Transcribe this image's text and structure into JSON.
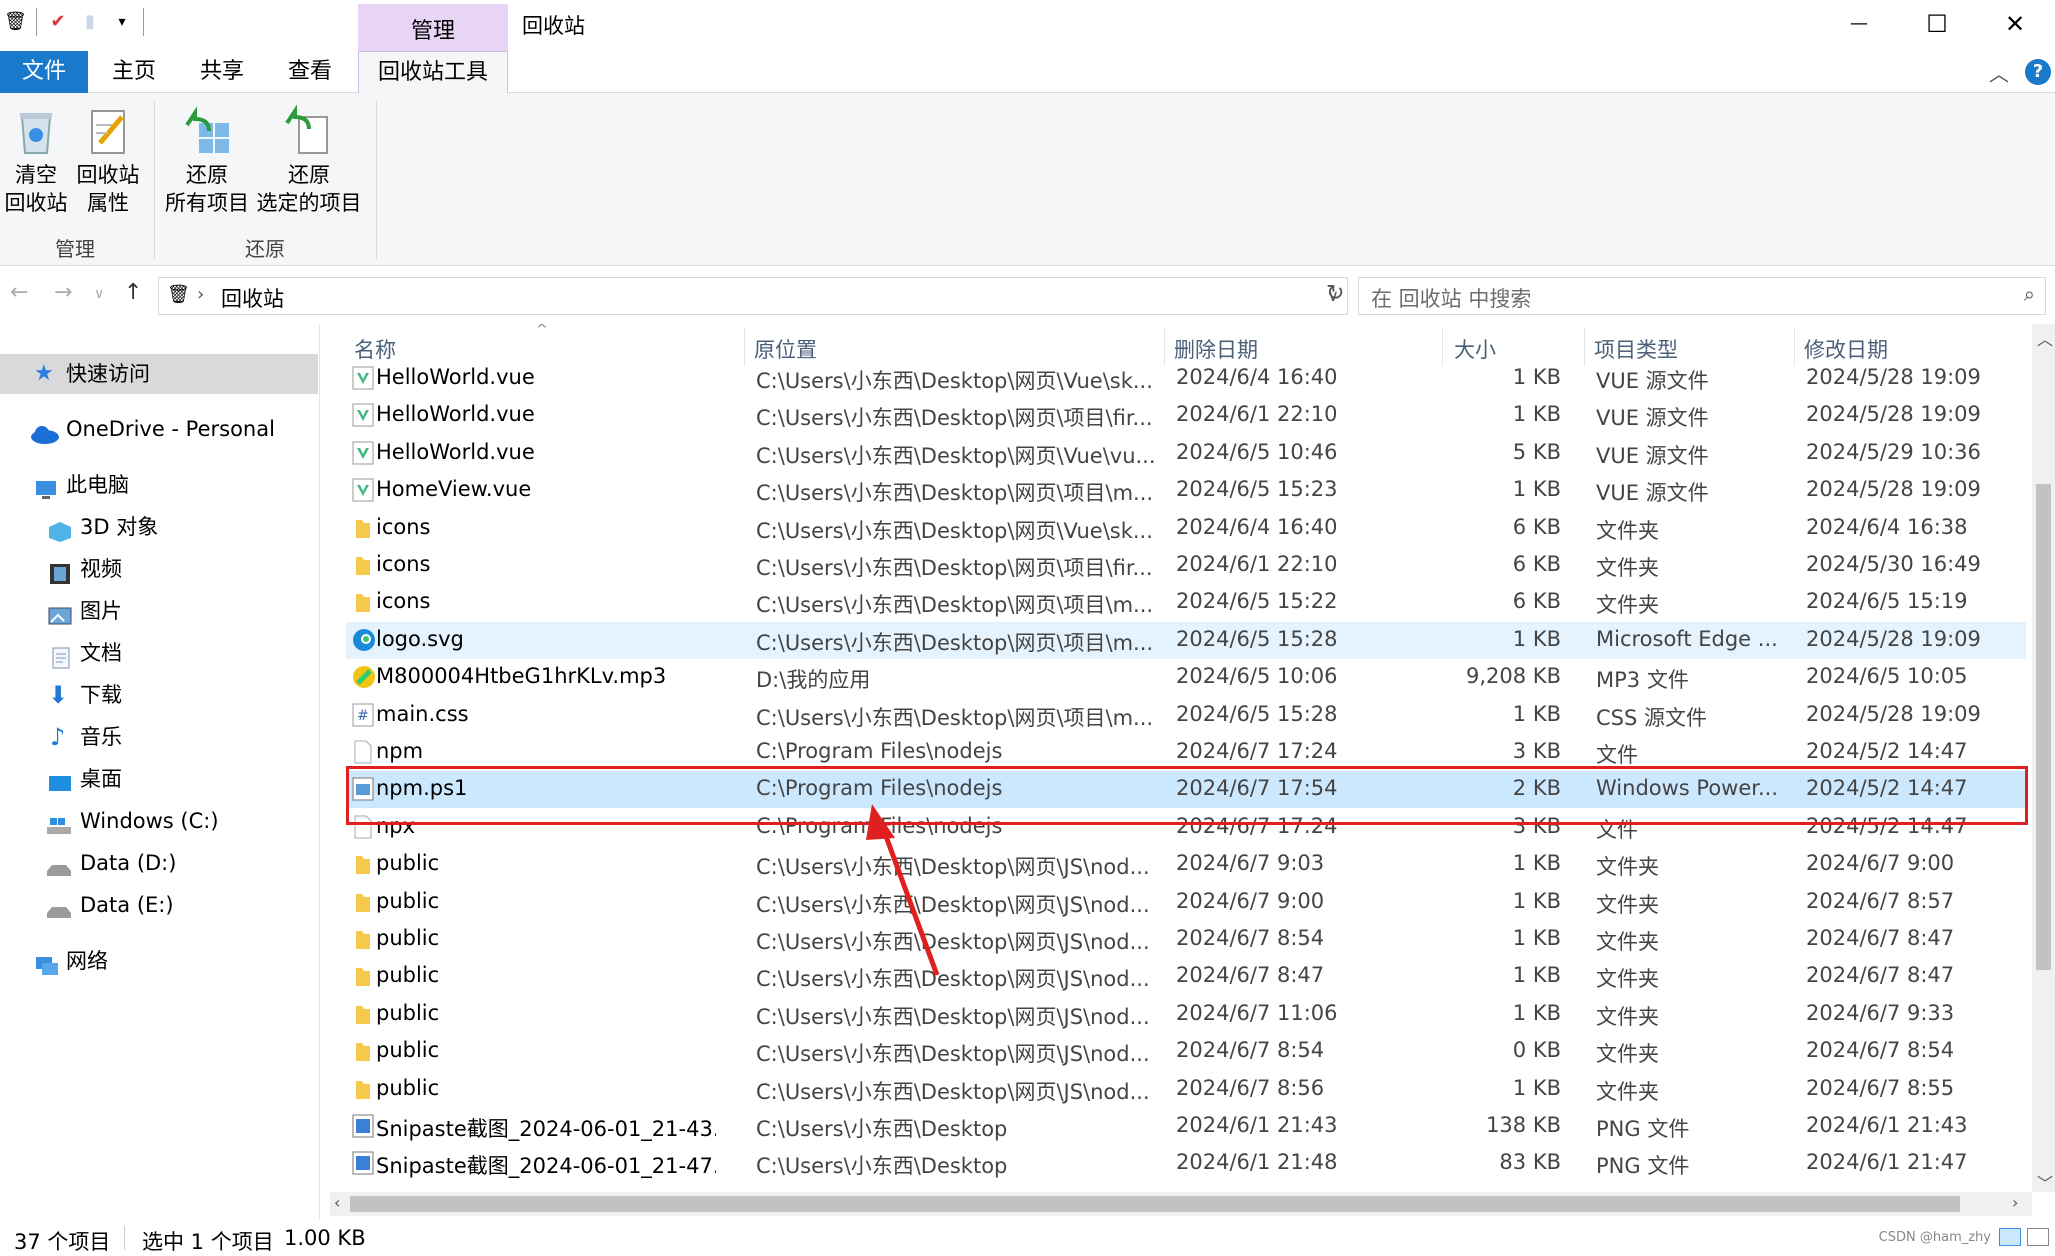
{
  "title_bar": {
    "context_tab": "管理",
    "window_title": "回收站",
    "minimize": "—",
    "maximize": "☐",
    "close": "✕"
  },
  "ribbon_tabs": {
    "file": "文件",
    "home": "主页",
    "share": "共享",
    "view": "查看",
    "recycle_tools": "回收站工具"
  },
  "ribbon": {
    "empty_bin": {
      "line1": "清空",
      "line2": "回收站"
    },
    "bin_props": {
      "line1": "回收站",
      "line2": "属性"
    },
    "restore_all": {
      "line1": "还原",
      "line2": "所有项目"
    },
    "restore_selected": {
      "line1": "还原",
      "line2": "选定的项目"
    },
    "group_manage": "管理",
    "group_restore": "还原"
  },
  "address": {
    "path": "回收站",
    "search_placeholder": "在 回收站 中搜索"
  },
  "nav": {
    "quick_access": "快速访问",
    "onedrive": "OneDrive - Personal",
    "this_pc": "此电脑",
    "objects_3d": "3D 对象",
    "videos": "视频",
    "pictures": "图片",
    "documents": "文档",
    "downloads": "下载",
    "music": "音乐",
    "desktop": "桌面",
    "drive_c": "Windows (C:)",
    "drive_d": "Data (D:)",
    "drive_e": "Data (E:)",
    "network": "网络"
  },
  "columns": {
    "name": "名称",
    "location": "原位置",
    "deleted": "删除日期",
    "size": "大小",
    "type": "项目类型",
    "modified": "修改日期"
  },
  "files": [
    {
      "name": "HelloWorld.vue",
      "loc": "C:\\Users\\小东西\\Desktop\\网页\\Vue\\sk...",
      "del": "2024/6/4 16:40",
      "size": "1 KB",
      "type": "VUE 源文件",
      "mod": "2024/5/28 19:09",
      "icon": "vue"
    },
    {
      "name": "HelloWorld.vue",
      "loc": "C:\\Users\\小东西\\Desktop\\网页\\项目\\fir...",
      "del": "2024/6/1 22:10",
      "size": "1 KB",
      "type": "VUE 源文件",
      "mod": "2024/5/28 19:09",
      "icon": "vue"
    },
    {
      "name": "HelloWorld.vue",
      "loc": "C:\\Users\\小东西\\Desktop\\网页\\Vue\\vu...",
      "del": "2024/6/5 10:46",
      "size": "5 KB",
      "type": "VUE 源文件",
      "mod": "2024/5/29 10:36",
      "icon": "vue"
    },
    {
      "name": "HomeView.vue",
      "loc": "C:\\Users\\小东西\\Desktop\\网页\\项目\\m...",
      "del": "2024/6/5 15:23",
      "size": "1 KB",
      "type": "VUE 源文件",
      "mod": "2024/5/28 19:09",
      "icon": "vue"
    },
    {
      "name": "icons",
      "loc": "C:\\Users\\小东西\\Desktop\\网页\\Vue\\sk...",
      "del": "2024/6/4 16:40",
      "size": "6 KB",
      "type": "文件夹",
      "mod": "2024/6/4 16:38",
      "icon": "folder"
    },
    {
      "name": "icons",
      "loc": "C:\\Users\\小东西\\Desktop\\网页\\项目\\fir...",
      "del": "2024/6/1 22:10",
      "size": "6 KB",
      "type": "文件夹",
      "mod": "2024/5/30 16:49",
      "icon": "folder"
    },
    {
      "name": "icons",
      "loc": "C:\\Users\\小东西\\Desktop\\网页\\项目\\m...",
      "del": "2024/6/5 15:22",
      "size": "6 KB",
      "type": "文件夹",
      "mod": "2024/6/5 15:19",
      "icon": "folder"
    },
    {
      "name": "logo.svg",
      "loc": "C:\\Users\\小东西\\Desktop\\网页\\项目\\m...",
      "del": "2024/6/5 15:28",
      "size": "1 KB",
      "type": "Microsoft Edge ...",
      "mod": "2024/5/28 19:09",
      "icon": "edge"
    },
    {
      "name": "M800004HtbeG1hrKLv.mp3",
      "loc": "D:\\我的应用",
      "del": "2024/6/5 10:06",
      "size": "9,208 KB",
      "type": "MP3 文件",
      "mod": "2024/6/5 10:05",
      "icon": "mp3"
    },
    {
      "name": "main.css",
      "loc": "C:\\Users\\小东西\\Desktop\\网页\\项目\\m...",
      "del": "2024/6/5 15:28",
      "size": "1 KB",
      "type": "CSS 源文件",
      "mod": "2024/5/28 19:09",
      "icon": "css"
    },
    {
      "name": "npm",
      "loc": "C:\\Program Files\\nodejs",
      "del": "2024/6/7 17:24",
      "size": "3 KB",
      "type": "文件",
      "mod": "2024/5/2 14:47",
      "icon": "file"
    },
    {
      "name": "npm.ps1",
      "loc": "C:\\Program Files\\nodejs",
      "del": "2024/6/7 17:54",
      "size": "2 KB",
      "type": "Windows Power...",
      "mod": "2024/5/2 14:47",
      "icon": "ps1"
    },
    {
      "name": "npx",
      "loc": "C:\\Program Files\\nodejs",
      "del": "2024/6/7 17:24",
      "size": "3 KB",
      "type": "文件",
      "mod": "2024/5/2 14:47",
      "icon": "file"
    },
    {
      "name": "public",
      "loc": "C:\\Users\\小东西\\Desktop\\网页\\JS\\nod...",
      "del": "2024/6/7 9:03",
      "size": "1 KB",
      "type": "文件夹",
      "mod": "2024/6/7 9:00",
      "icon": "folder"
    },
    {
      "name": "public",
      "loc": "C:\\Users\\小东西\\Desktop\\网页\\JS\\nod...",
      "del": "2024/6/7 9:00",
      "size": "1 KB",
      "type": "文件夹",
      "mod": "2024/6/7 8:57",
      "icon": "folder"
    },
    {
      "name": "public",
      "loc": "C:\\Users\\小东西\\Desktop\\网页\\JS\\nod...",
      "del": "2024/6/7 8:54",
      "size": "1 KB",
      "type": "文件夹",
      "mod": "2024/6/7 8:47",
      "icon": "folder"
    },
    {
      "name": "public",
      "loc": "C:\\Users\\小东西\\Desktop\\网页\\JS\\nod...",
      "del": "2024/6/7 8:47",
      "size": "1 KB",
      "type": "文件夹",
      "mod": "2024/6/7 8:47",
      "icon": "folder"
    },
    {
      "name": "public",
      "loc": "C:\\Users\\小东西\\Desktop\\网页\\JS\\nod...",
      "del": "2024/6/7 11:06",
      "size": "1 KB",
      "type": "文件夹",
      "mod": "2024/6/7 9:33",
      "icon": "folder"
    },
    {
      "name": "public",
      "loc": "C:\\Users\\小东西\\Desktop\\网页\\JS\\nod...",
      "del": "2024/6/7 8:54",
      "size": "0 KB",
      "type": "文件夹",
      "mod": "2024/6/7 8:54",
      "icon": "folder"
    },
    {
      "name": "public",
      "loc": "C:\\Users\\小东西\\Desktop\\网页\\JS\\nod...",
      "del": "2024/6/7 8:56",
      "size": "1 KB",
      "type": "文件夹",
      "mod": "2024/6/7 8:55",
      "icon": "folder"
    },
    {
      "name": "Snipaste截图_2024-06-01_21-43...",
      "loc": "C:\\Users\\小东西\\Desktop",
      "del": "2024/6/1 21:43",
      "size": "138 KB",
      "type": "PNG 文件",
      "mod": "2024/6/1 21:43",
      "icon": "png"
    },
    {
      "name": "Snipaste截图_2024-06-01_21-47...",
      "loc": "C:\\Users\\小东西\\Desktop",
      "del": "2024/6/1 21:48",
      "size": "83 KB",
      "type": "PNG 文件",
      "mod": "2024/6/1 21:47",
      "icon": "png"
    }
  ],
  "status": {
    "count": "37 个项目",
    "selection": "选中 1 个项目",
    "sel_size": "1.00 KB",
    "watermark": "CSDN @ham_zhy"
  },
  "colors": {
    "file_tab": "#1979ca",
    "context_header": "#e8d4f5",
    "selected_row": "#cce8ff",
    "hover_row": "#e5f3ff",
    "annotation": "#e02020"
  }
}
